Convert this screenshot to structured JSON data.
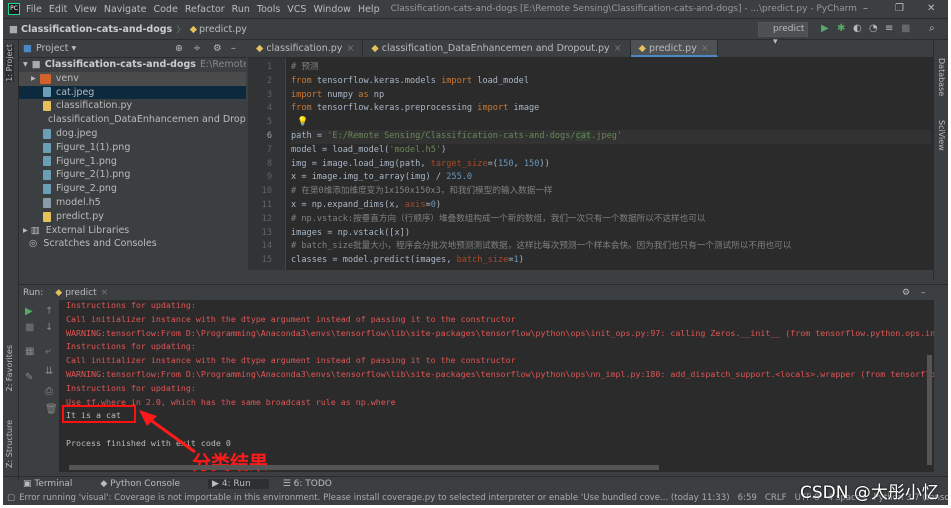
{
  "window": {
    "title": "Classification-cats-and-dogs [E:\\Remote Sensing\\Classification-cats-and-dogs] - ...\\predict.py - PyCharm",
    "logo": "PC",
    "menu": [
      "File",
      "Edit",
      "View",
      "Navigate",
      "Code",
      "Refactor",
      "Run",
      "Tools",
      "VCS",
      "Window",
      "Help"
    ]
  },
  "navbar": {
    "project": "Classification-cats-and-dogs",
    "file": "predict.py",
    "run_config": "predict"
  },
  "sidebar": {
    "left_tabs": [
      "1: Project",
      "2: Favorites",
      "Z: Structure"
    ],
    "right_tabs": [
      "Database",
      "SciView"
    ]
  },
  "project": {
    "header": "Project",
    "root": "Classification-cats-and-dogs",
    "root_path": "E:\\Remote Sensing\\",
    "items": [
      {
        "label": "venv",
        "type": "folder"
      },
      {
        "label": "cat.jpeg",
        "type": "image",
        "selected": true
      },
      {
        "label": "classification.py",
        "type": "python"
      },
      {
        "label": "classification_DataEnhancemen and Dropout.py",
        "type": "python"
      },
      {
        "label": "dog.jpeg",
        "type": "image"
      },
      {
        "label": "Figure_1(1).png",
        "type": "image"
      },
      {
        "label": "Figure_1.png",
        "type": "image"
      },
      {
        "label": "Figure_2(1).png",
        "type": "image"
      },
      {
        "label": "Figure_2.png",
        "type": "image"
      },
      {
        "label": "model.h5",
        "type": "unknown"
      },
      {
        "label": "predict.py",
        "type": "python"
      }
    ],
    "external": "External Libraries",
    "scratches": "Scratches and Consoles"
  },
  "editor": {
    "tabs": [
      {
        "label": "classification.py"
      },
      {
        "label": "classification_DataEnhancemen and Dropout.py"
      },
      {
        "label": "predict.py",
        "active": true
      }
    ],
    "lines": [
      [
        [
          "com",
          "# 预测"
        ]
      ],
      [
        [
          "kw",
          "from "
        ],
        [
          "",
          "tensorflow.keras.models "
        ],
        [
          "kw",
          "import "
        ],
        [
          "",
          "load_model"
        ]
      ],
      [
        [
          "kw",
          "import "
        ],
        [
          "",
          "numpy "
        ],
        [
          "kw",
          "as "
        ],
        [
          "",
          "np"
        ]
      ],
      [
        [
          "kw",
          "from "
        ],
        [
          "",
          "tensorflow.keras.preprocessing "
        ],
        [
          "kw",
          "import "
        ],
        [
          "",
          "image"
        ]
      ],
      [
        [
          "",
          ""
        ]
      ],
      [
        [
          "",
          "path = "
        ],
        [
          "str",
          "'E:/Remote Sensing/Classification-cats-and-dogs/"
        ],
        [
          "sel",
          "cat"
        ],
        [
          "str",
          ".jpeg'"
        ]
      ],
      [
        [
          "",
          "model = load_model("
        ],
        [
          "str",
          "'model.h5'"
        ],
        [
          "",
          ")"
        ]
      ],
      [
        [
          "",
          "img = image.load_img(path, "
        ],
        [
          "param",
          "target_size"
        ],
        [
          "",
          "=("
        ],
        [
          "num",
          "150"
        ],
        [
          "",
          ", "
        ],
        [
          "num",
          "150"
        ],
        [
          "",
          "))"
        ]
      ],
      [
        [
          "",
          "x = image.img_to_array(img) / "
        ],
        [
          "num",
          "255.0"
        ]
      ],
      [
        [
          "com",
          "# 在第0维添加维度变为1x150x150x3，和我们模型的输入数据一样"
        ]
      ],
      [
        [
          "",
          "x = np.expand_dims(x, "
        ],
        [
          "param",
          "axis"
        ],
        [
          "",
          "="
        ],
        [
          "num",
          "0"
        ],
        [
          "",
          ")"
        ]
      ],
      [
        [
          "com",
          "# np.vstack:按垂直方向（行顺序）堆叠数组构成一个新的数组，我们一次只有一个数据所以不这样也可以"
        ]
      ],
      [
        [
          "",
          "images = np.vstack([x])"
        ]
      ],
      [
        [
          "com",
          "# batch_size批量大小，程序会分批次地预测测试数据，这样比每次预测一个样本会快。因为我们也只有一个测试所以不用也可以"
        ]
      ],
      [
        [
          "",
          "classes = model.predict(images, "
        ],
        [
          "param",
          "batch_size"
        ],
        [
          "",
          "="
        ],
        [
          "num",
          "1"
        ],
        [
          "",
          ")"
        ]
      ]
    ]
  },
  "run": {
    "label": "Run:",
    "config": "predict",
    "output": [
      {
        "t": "err",
        "text": "Instructions for updating:"
      },
      {
        "t": "err",
        "text": "Call initializer instance with the dtype argument instead of passing it to the constructor"
      },
      {
        "t": "err",
        "text": "WARNING:tensorflow:From D:\\Programming\\Anaconda3\\envs\\tensorflow\\lib\\site-packages\\tensorflow\\python\\ops\\init_ops.py:97: calling Zeros.__init__ (from tensorflow.python.ops.init_op"
      },
      {
        "t": "err",
        "text": "Instructions for updating:"
      },
      {
        "t": "err",
        "text": "Call initializer instance with the dtype argument instead of passing it to the constructor"
      },
      {
        "t": "err",
        "text": "WARNING:tensorflow:From D:\\Programming\\Anaconda3\\envs\\tensorflow\\lib\\site-packages\\tensorflow\\python\\ops\\nn_impl.py:180: add_dispatch_support.<locals>.wrapper (from tensorflow.pyt"
      },
      {
        "t": "err",
        "text": "Instructions for updating:"
      },
      {
        "t": "err",
        "text": "Use tf.where in 2.0, which has the same broadcast rule as np.where"
      },
      {
        "t": "out",
        "text": "It is a cat"
      },
      {
        "t": "out",
        "text": ""
      },
      {
        "t": "out",
        "text": "Process finished with exit code 0"
      }
    ],
    "annotation": "分类结果"
  },
  "bottom_tabs": [
    "Terminal",
    "Python Console",
    "4: Run",
    "6: TODO"
  ],
  "status": {
    "message": "Error running 'visual': Coverage is not importable in this environment. Please install coverage.py to selected interpreter or enable 'Use bundled cove... (today 11:33)",
    "position": "6:59",
    "line_sep": "CRLF",
    "encoding": "UTF-8",
    "indent": "4 spaces",
    "interpreter": "Python 3.7 (tensorflow)"
  },
  "watermark": "CSDN @大彤小忆",
  "colors": {
    "keyword": "#cc7832",
    "string": "#6a8759",
    "number": "#6897bb",
    "comment": "#808080",
    "error": "#e25454",
    "highlight": "#ff1010"
  }
}
